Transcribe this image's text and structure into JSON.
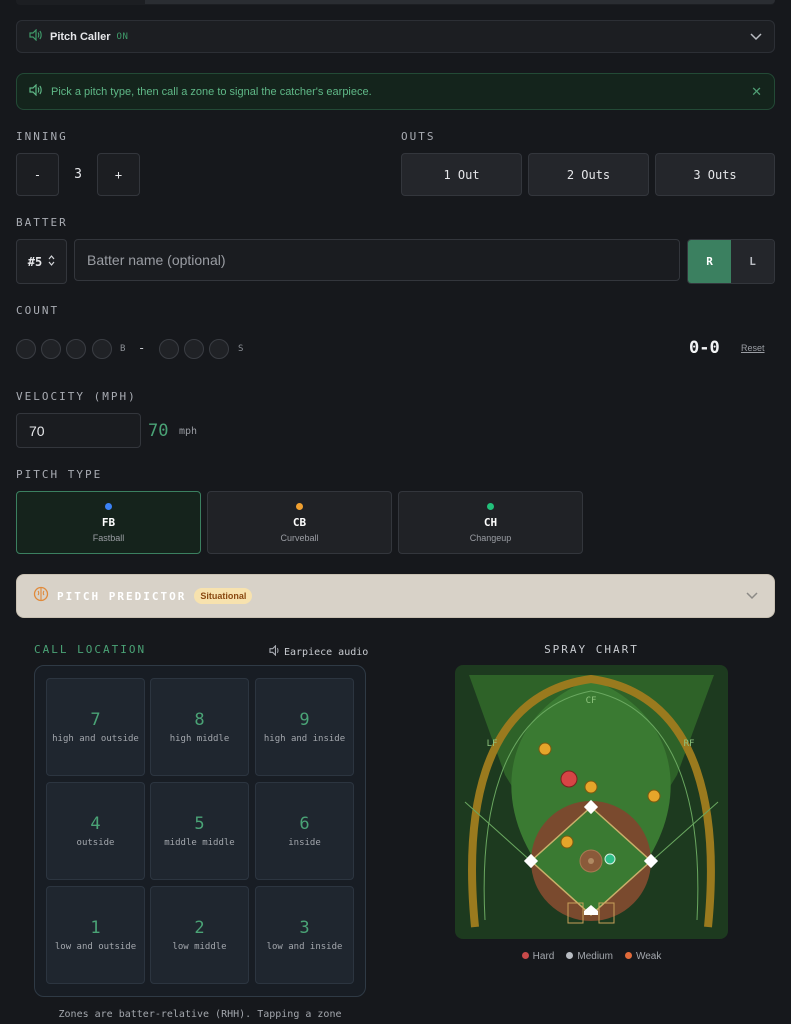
{
  "pitch_caller": {
    "label": "Pitch Caller",
    "status": "ON"
  },
  "notice": {
    "text": "Pick a pitch type, then call a zone to signal the catcher's earpiece."
  },
  "inning": {
    "label": "INNING",
    "minus": "-",
    "value": "3",
    "plus": "+"
  },
  "outs": {
    "label": "OUTS",
    "options": [
      "1 Out",
      "2 Outs",
      "3 Outs"
    ]
  },
  "batter": {
    "label": "BATTER",
    "number": "#5",
    "name_placeholder": "Batter name (optional)",
    "hands": [
      "R",
      "L"
    ],
    "selected_hand": "R"
  },
  "count": {
    "label": "COUNT",
    "balls_label": "B",
    "separator": "-",
    "strikes_label": "S",
    "display": "0-0",
    "reset": "Reset"
  },
  "velocity": {
    "label": "VELOCITY (MPH)",
    "input_value": "70",
    "display": "70",
    "unit": "mph"
  },
  "pitch_type": {
    "label": "PITCH TYPE",
    "options": [
      {
        "code": "FB",
        "name": "Fastball",
        "color": "#3b82f6"
      },
      {
        "code": "CB",
        "name": "Curveball",
        "color": "#f0a030"
      },
      {
        "code": "CH",
        "name": "Changeup",
        "color": "#22c07a"
      }
    ],
    "selected": "FB"
  },
  "predictor": {
    "title": "PITCH PREDICTOR",
    "badge": "Situational"
  },
  "call_location": {
    "title": "CALL LOCATION",
    "audio": "Earpiece audio",
    "zones": [
      {
        "num": "7",
        "label": "high and outside"
      },
      {
        "num": "8",
        "label": "high middle"
      },
      {
        "num": "9",
        "label": "high and inside"
      },
      {
        "num": "4",
        "label": "outside"
      },
      {
        "num": "5",
        "label": "middle middle"
      },
      {
        "num": "6",
        "label": "inside"
      },
      {
        "num": "1",
        "label": "low and outside"
      },
      {
        "num": "2",
        "label": "low middle"
      },
      {
        "num": "3",
        "label": "low and inside"
      }
    ],
    "footnote": "Zones are batter-relative (RHH). Tapping a zone"
  },
  "spray_chart": {
    "title": "SPRAY CHART",
    "field_labels": {
      "cf": "CF",
      "lf": "LF",
      "rf": "RF"
    },
    "legend": [
      {
        "label": "Hard",
        "color": "#c94a4a"
      },
      {
        "label": "Medium",
        "color": "#b8bcc2"
      },
      {
        "label": "Weak",
        "color": "#e06a3a"
      }
    ]
  }
}
